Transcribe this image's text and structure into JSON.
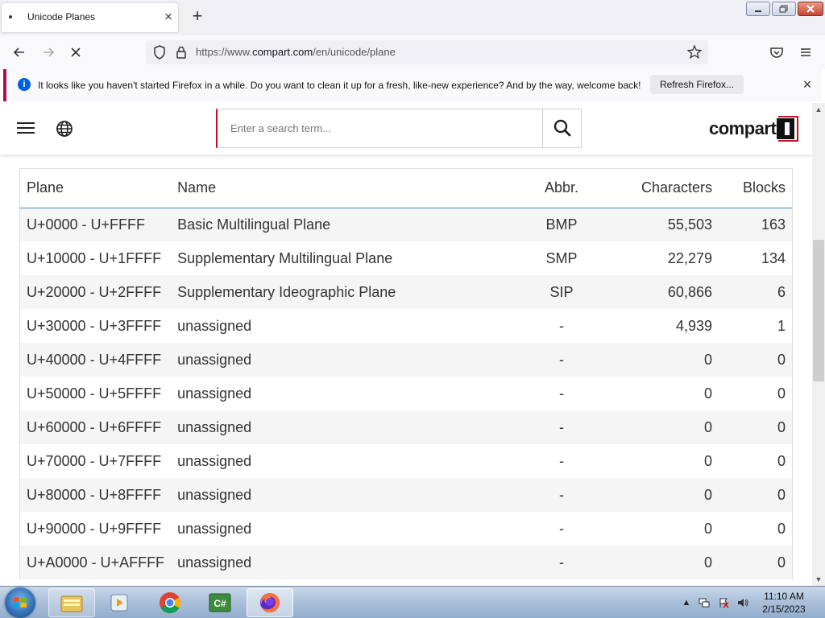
{
  "browser": {
    "tab_title": "Unicode Planes",
    "tab_close": "×",
    "new_tab": "+",
    "url_prefix": "https://www.",
    "url_domain": "compart.com",
    "url_path": "/en/unicode/plane",
    "infobar_message": "It looks like you haven't started Firefox in a while. Do you want to clean it up for a fresh, like-new experience? And by the way, welcome back!",
    "infobar_button": "Refresh Firefox...",
    "infobar_close": "×"
  },
  "header": {
    "search_placeholder": "Enter a search term...",
    "logo_text": "compart"
  },
  "table": {
    "columns": [
      "Plane",
      "Name",
      "Abbr.",
      "Characters",
      "Blocks"
    ],
    "rows": [
      [
        "U+0000 - U+FFFF",
        "Basic Multilingual Plane",
        "BMP",
        "55,503",
        "163"
      ],
      [
        "U+10000 - U+1FFFF",
        "Supplementary Multilingual Plane",
        "SMP",
        "22,279",
        "134"
      ],
      [
        "U+20000 - U+2FFFF",
        "Supplementary Ideographic Plane",
        "SIP",
        "60,866",
        "6"
      ],
      [
        "U+30000 - U+3FFFF",
        "unassigned",
        "-",
        "4,939",
        "1"
      ],
      [
        "U+40000 - U+4FFFF",
        "unassigned",
        "-",
        "0",
        "0"
      ],
      [
        "U+50000 - U+5FFFF",
        "unassigned",
        "-",
        "0",
        "0"
      ],
      [
        "U+60000 - U+6FFFF",
        "unassigned",
        "-",
        "0",
        "0"
      ],
      [
        "U+70000 - U+7FFFF",
        "unassigned",
        "-",
        "0",
        "0"
      ],
      [
        "U+80000 - U+8FFFF",
        "unassigned",
        "-",
        "0",
        "0"
      ],
      [
        "U+90000 - U+9FFFF",
        "unassigned",
        "-",
        "0",
        "0"
      ],
      [
        "U+A0000 - U+AFFFF",
        "unassigned",
        "-",
        "0",
        "0"
      ]
    ]
  },
  "taskbar": {
    "time": "11:10 AM",
    "date": "2/15/2023",
    "csharp_label": "C#"
  },
  "colors": {
    "accent_red": "#c1121f",
    "header_rule_blue": "#4a8cc0",
    "infobar_stripe": "#a7115a"
  }
}
